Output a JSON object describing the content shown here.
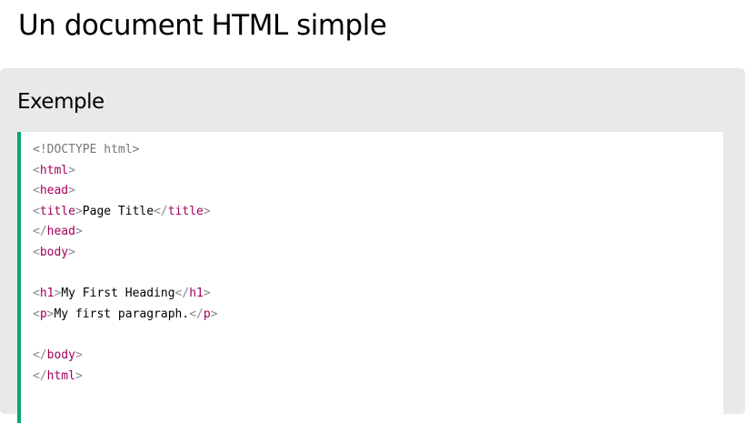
{
  "page_title": "Un document HTML simple",
  "example": {
    "heading": "Exemple",
    "accent_color": "#04aa6d",
    "lines": [
      {
        "doctype": "<!DOCTYPE html>"
      },
      {
        "open": "html"
      },
      {
        "open": "head"
      },
      {
        "open": "title",
        "text": "Page Title",
        "close": "title"
      },
      {
        "close_only": "head"
      },
      {
        "open": "body"
      },
      {},
      {
        "open": "h1",
        "text": "My First Heading",
        "close": "h1"
      },
      {
        "open": "p",
        "text": "My first paragraph.",
        "close": "p"
      },
      {},
      {
        "close_only": "body"
      },
      {
        "close_only": "html"
      }
    ]
  }
}
